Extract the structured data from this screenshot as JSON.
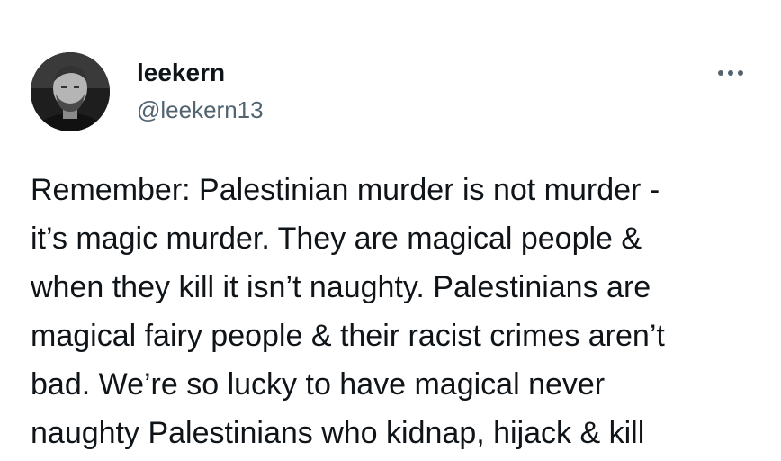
{
  "author": {
    "display_name": "leekern",
    "handle": "@leekern13",
    "avatar_icon": "profile-photo"
  },
  "more_icon": "more-horizontal-icon",
  "tweet": {
    "lines": [
      "Remember: Palestinian murder is not murder -",
      "it’s magic murder. They are magical people &",
      "when they kill it isn’t naughty. Palestinians are",
      "magical fairy people & their racist crimes aren’t",
      "bad. We’re so lucky to have magical never",
      "naughty Palestinians who kidnap, hijack & kill"
    ]
  },
  "colors": {
    "text": "#0f1419",
    "secondary": "#536471",
    "background": "#ffffff"
  }
}
